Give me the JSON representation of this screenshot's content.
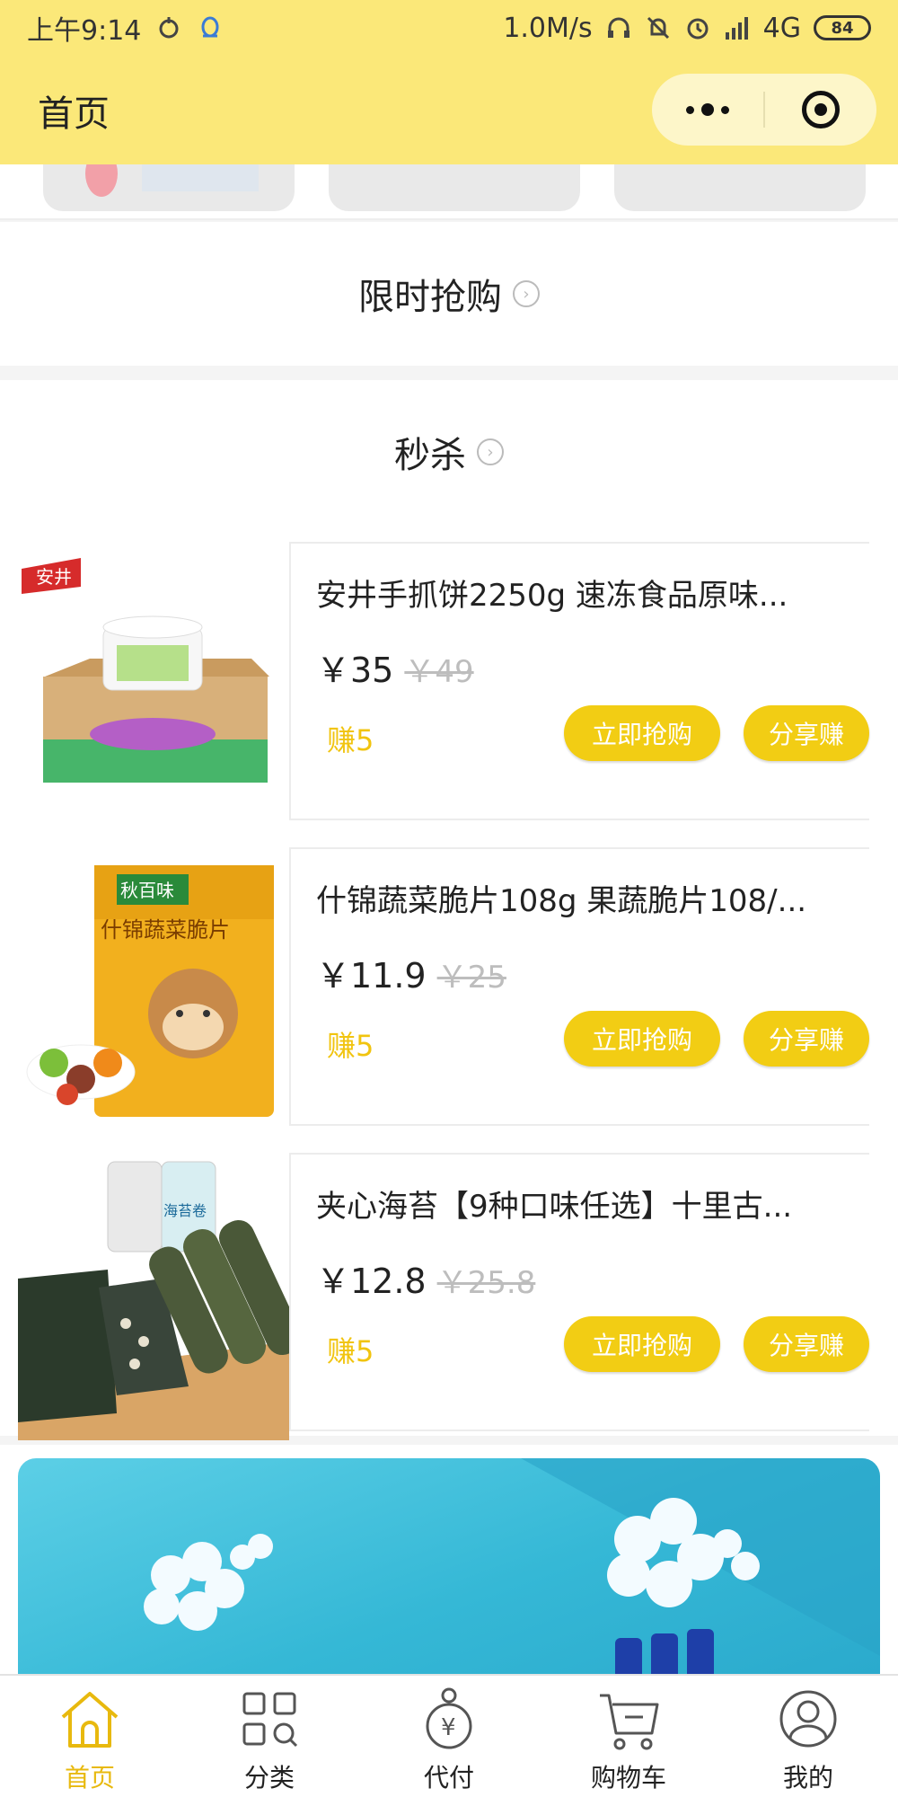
{
  "status_bar": {
    "time": "上午9:14",
    "speed": "1.0M/s",
    "network": "4G",
    "battery": "84"
  },
  "nav": {
    "title": "首页"
  },
  "sections": {
    "flash_sale_title": "限时抢购",
    "seckill_title": "秒杀"
  },
  "products": [
    {
      "title": "安井手抓饼2250g 速冻食品原味...",
      "price": "￥35",
      "old_price": "￥49",
      "earn": "赚5",
      "buy_label": "立即抢购",
      "share_label": "分享赚"
    },
    {
      "title": "什锦蔬菜脆片108g 果蔬脆片108/...",
      "price": "￥11.9",
      "old_price": "￥25",
      "earn": "赚5",
      "buy_label": "立即抢购",
      "share_label": "分享赚"
    },
    {
      "title": "夹心海苔【9种口味任选】十里古...",
      "price": "￥12.8",
      "old_price": "￥25.8",
      "earn": "赚5",
      "buy_label": "立即抢购",
      "share_label": "分享赚"
    }
  ],
  "product_image_text": {
    "p1_brand": "安井",
    "p2_brand": "秋百味",
    "p2_name": "什锦蔬菜脆片",
    "p3_name": "海苔卷"
  },
  "tabbar": {
    "items": [
      {
        "label": "首页",
        "icon": "home-icon",
        "active": true
      },
      {
        "label": "分类",
        "icon": "category-icon",
        "active": false
      },
      {
        "label": "代付",
        "icon": "pay-for-me-icon",
        "active": false
      },
      {
        "label": "购物车",
        "icon": "cart-icon",
        "active": false
      },
      {
        "label": "我的",
        "icon": "profile-icon",
        "active": false
      }
    ]
  },
  "colors": {
    "header_bg": "#fbe879",
    "accent": "#f2cd14",
    "active_tab": "#e8b90e",
    "earn_text": "#f1c40f"
  }
}
